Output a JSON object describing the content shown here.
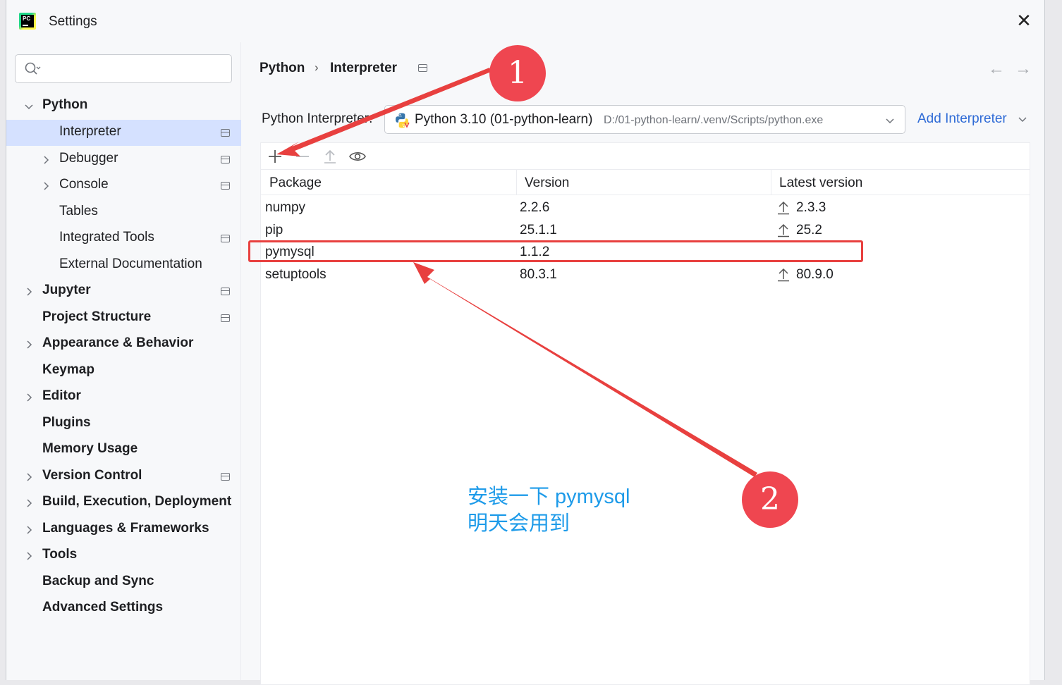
{
  "window": {
    "title": "Settings"
  },
  "sidebar": {
    "search_placeholder": "",
    "items": [
      {
        "label": "Python",
        "bold": true,
        "expanded": true
      },
      {
        "label": "Interpreter",
        "selected": true
      },
      {
        "label": "Debugger"
      },
      {
        "label": "Console"
      },
      {
        "label": "Tables"
      },
      {
        "label": "Integrated Tools"
      },
      {
        "label": "External Documentation"
      },
      {
        "label": "Jupyter"
      },
      {
        "label": "Project Structure"
      },
      {
        "label": "Appearance & Behavior"
      },
      {
        "label": "Keymap"
      },
      {
        "label": "Editor"
      },
      {
        "label": "Plugins"
      },
      {
        "label": "Memory Usage"
      },
      {
        "label": "Version Control"
      },
      {
        "label": "Build, Execution, Deployment"
      },
      {
        "label": "Languages & Frameworks"
      },
      {
        "label": "Tools"
      },
      {
        "label": "Backup and Sync"
      },
      {
        "label": "Advanced Settings"
      }
    ]
  },
  "breadcrumb": {
    "parent": "Python",
    "separator": "›",
    "current": "Interpreter"
  },
  "nav": {
    "back": "←",
    "forward": "→"
  },
  "interpreter": {
    "label": "Python Interpreter:",
    "name": "Python 3.10 (01-python-learn)",
    "path": "D:/01-python-learn/.venv/Scripts/python.exe",
    "add_label": "Add Interpreter"
  },
  "packages": {
    "columns": [
      "Package",
      "Version",
      "Latest version"
    ],
    "rows": [
      {
        "name": "numpy",
        "version": "2.2.6",
        "latest": "2.3.3"
      },
      {
        "name": "pip",
        "version": "25.1.1",
        "latest": "25.2"
      },
      {
        "name": "pymysql",
        "version": "1.1.2",
        "latest": ""
      },
      {
        "name": "setuptools",
        "version": "80.3.1",
        "latest": "80.9.0"
      }
    ]
  },
  "annotations": {
    "badge1": "1",
    "badge2": "2",
    "note_line1": "安装一下 pymysql",
    "note_line2": "明天会用到",
    "color": "#e8403f",
    "note_color": "#1e9be9"
  }
}
